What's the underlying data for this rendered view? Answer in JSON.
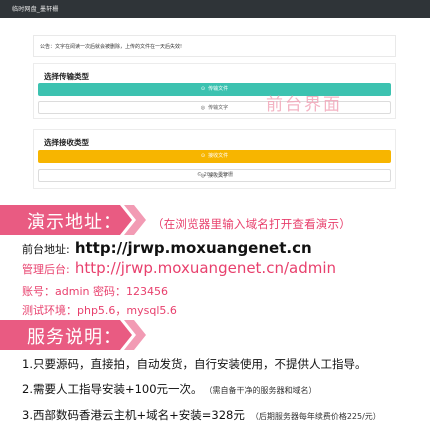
{
  "topbar": {
    "title": "临时网盘_墨轩栅"
  },
  "preview": {
    "notice": "公告：文字在阅读一次后就会被删除，上传的文件在一天后失效!",
    "send_panel": {
      "heading": "选择传输类型",
      "primary_button": "传输文件",
      "secondary_button": "传输文字"
    },
    "receive_panel": {
      "heading": "选择接收类型",
      "primary_button": "接收文件",
      "secondary_button": "接收文字"
    },
    "copyright": "© 2023 墨轩栅",
    "watermark": "前台界面"
  },
  "demo": {
    "banner": "演示地址：",
    "note": "（在浏览器里输入域名打开查看演示）",
    "front_label": "前台地址:",
    "front_url": "http://jrwp.moxuangenet.cn",
    "admin_label": "管理后台:",
    "admin_url": "http://jrwp.moxuangenet.cn/admin",
    "account": "账号：admin   密码：123456",
    "env": "测试环境：php5.6，mysql5.6"
  },
  "service": {
    "banner": "服务说明：",
    "item1": "1.只要源码，直接拍，自动发货，自行安装使用，不提供人工指导。",
    "item2": "2.需要人工指导安装+100元一次。",
    "item2_note": "（需自备干净的服务器和域名）",
    "item3": "3.西部数码香港云主机+域名+安装=328元",
    "item3_note": "（后期服务器每年续费价格225/元）"
  },
  "colors": {
    "banner_pink": "#e95b82",
    "accent_pink": "#e8406d",
    "teal": "#3cc2b0",
    "yellow": "#f7b500"
  }
}
